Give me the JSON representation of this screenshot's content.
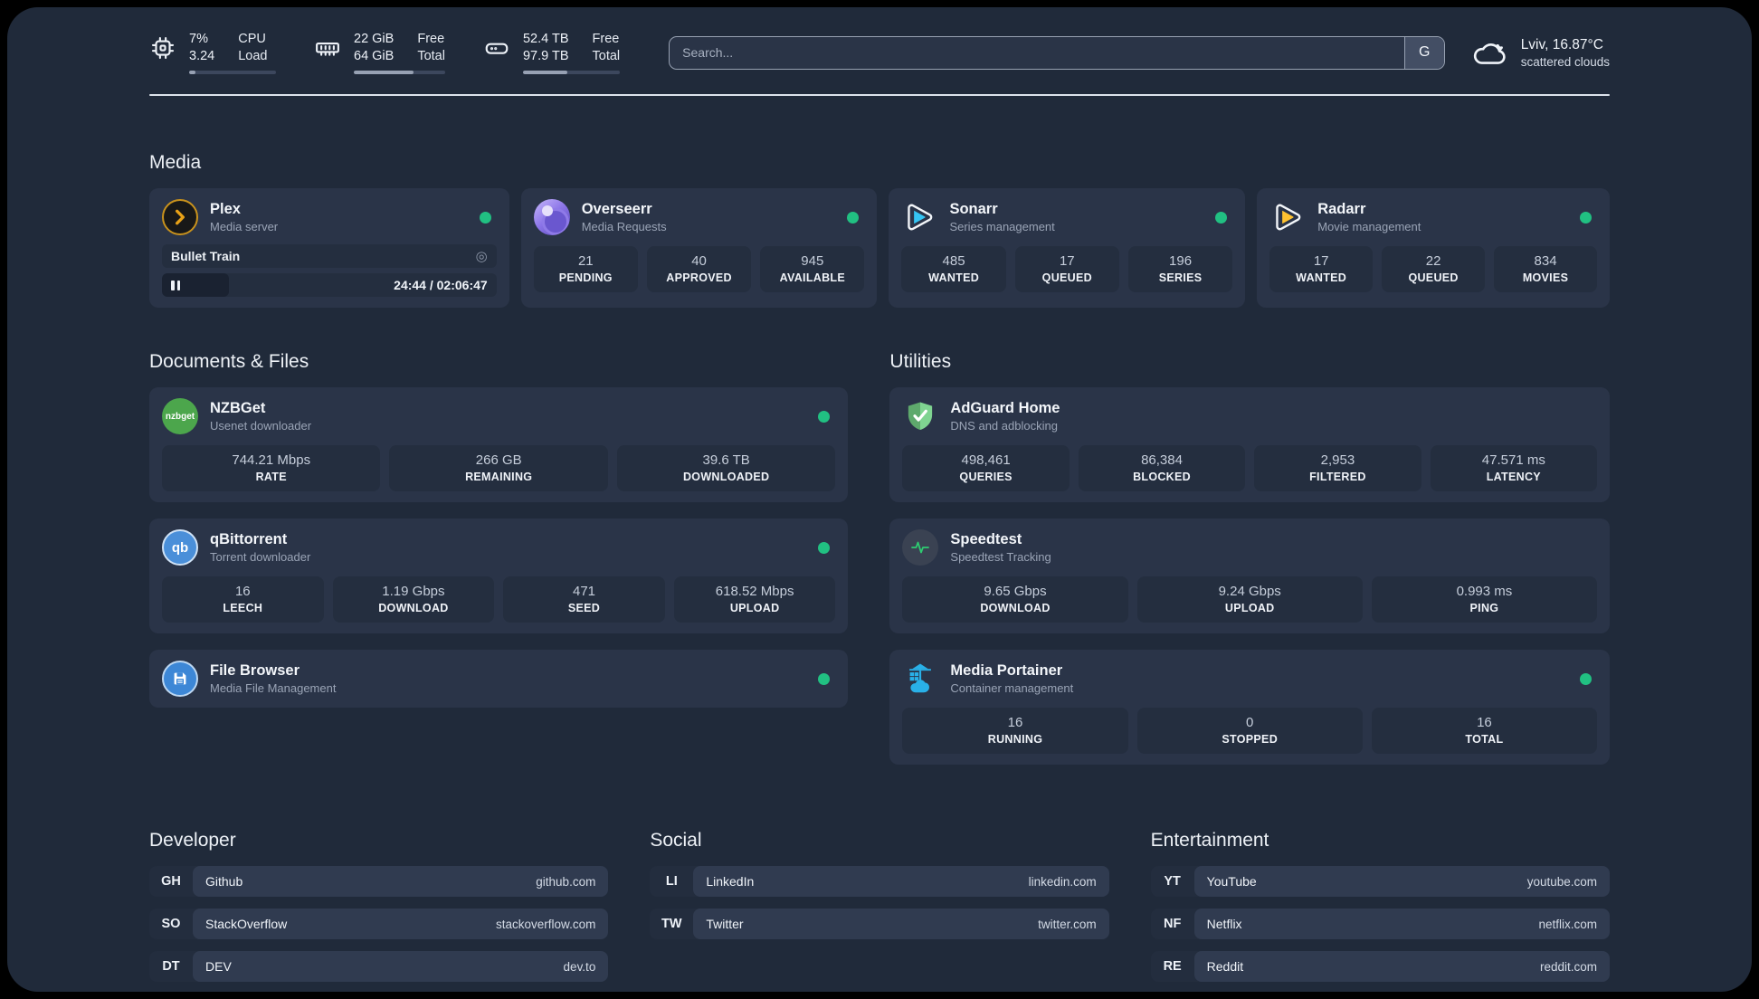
{
  "colors": {
    "background": "#202a3a",
    "card": "#2a3448",
    "tile": "#242e3f",
    "status_online": "#21c082",
    "plex_gold": "#e8a117",
    "sonarr_blue": "#35c5f4",
    "radarr_yellow": "#ffc230",
    "nzbget_green": "#4ca64c",
    "qbittorrent_blue": "#4a8fd9",
    "adguard_green": "#6fbe80",
    "speedtest_pulse": "#2ecc71",
    "portainer_blue": "#29b0e8"
  },
  "header": {
    "cpu": {
      "value_line1": "7%",
      "value_line2": "3.24",
      "label_line1": "CPU",
      "label_line2": "Load",
      "usage_percent": 7
    },
    "memory": {
      "value_line1": "22 GiB",
      "value_line2": "64 GiB",
      "label_line1": "Free",
      "label_line2": "Total",
      "usage_percent": 65
    },
    "storage": {
      "value_line1": "52.4 TB",
      "value_line2": "97.9 TB",
      "label_line1": "Free",
      "label_line2": "Total",
      "usage_percent": 46
    },
    "search": {
      "placeholder": "Search...",
      "engine_label": "G"
    },
    "weather": {
      "location": "Lviv, 16.87°C",
      "condition": "scattered clouds"
    }
  },
  "sections": {
    "media": "Media",
    "documents": "Documents & Files",
    "utilities": "Utilities",
    "developer": "Developer",
    "social": "Social",
    "entertainment": "Entertainment"
  },
  "services": {
    "plex": {
      "title": "Plex",
      "subtitle": "Media server",
      "status": "online",
      "now_playing": {
        "title": "Bullet Train",
        "time": "24:44 / 02:06:47",
        "progress_percent": 20
      }
    },
    "overseerr": {
      "title": "Overseerr",
      "subtitle": "Media Requests",
      "status": "online",
      "stats": [
        {
          "value": "21",
          "label": "PENDING"
        },
        {
          "value": "40",
          "label": "APPROVED"
        },
        {
          "value": "945",
          "label": "AVAILABLE"
        }
      ]
    },
    "sonarr": {
      "title": "Sonarr",
      "subtitle": "Series management",
      "status": "online",
      "stats": [
        {
          "value": "485",
          "label": "WANTED"
        },
        {
          "value": "17",
          "label": "QUEUED"
        },
        {
          "value": "196",
          "label": "SERIES"
        }
      ]
    },
    "radarr": {
      "title": "Radarr",
      "subtitle": "Movie management",
      "status": "online",
      "stats": [
        {
          "value": "17",
          "label": "WANTED"
        },
        {
          "value": "22",
          "label": "QUEUED"
        },
        {
          "value": "834",
          "label": "MOVIES"
        }
      ]
    },
    "nzbget": {
      "title": "NZBGet",
      "subtitle": "Usenet downloader",
      "status": "online",
      "stats": [
        {
          "value": "744.21 Mbps",
          "label": "RATE"
        },
        {
          "value": "266 GB",
          "label": "REMAINING"
        },
        {
          "value": "39.6 TB",
          "label": "DOWNLOADED"
        }
      ]
    },
    "qbittorrent": {
      "title": "qBittorrent",
      "subtitle": "Torrent downloader",
      "status": "online",
      "stats": [
        {
          "value": "16",
          "label": "LEECH"
        },
        {
          "value": "1.19 Gbps",
          "label": "DOWNLOAD"
        },
        {
          "value": "471",
          "label": "SEED"
        },
        {
          "value": "618.52 Mbps",
          "label": "UPLOAD"
        }
      ]
    },
    "filebrowser": {
      "title": "File Browser",
      "subtitle": "Media File Management",
      "status": "online"
    },
    "adguard": {
      "title": "AdGuard Home",
      "subtitle": "DNS and adblocking",
      "stats": [
        {
          "value": "498,461",
          "label": "QUERIES"
        },
        {
          "value": "86,384",
          "label": "BLOCKED"
        },
        {
          "value": "2,953",
          "label": "FILTERED"
        },
        {
          "value": "47.571 ms",
          "label": "LATENCY"
        }
      ]
    },
    "speedtest": {
      "title": "Speedtest",
      "subtitle": "Speedtest Tracking",
      "stats": [
        {
          "value": "9.65 Gbps",
          "label": "DOWNLOAD"
        },
        {
          "value": "9.24 Gbps",
          "label": "UPLOAD"
        },
        {
          "value": "0.993 ms",
          "label": "PING"
        }
      ]
    },
    "portainer": {
      "title": "Media Portainer",
      "subtitle": "Container management",
      "status": "online",
      "stats": [
        {
          "value": "16",
          "label": "RUNNING"
        },
        {
          "value": "0",
          "label": "STOPPED"
        },
        {
          "value": "16",
          "label": "TOTAL"
        }
      ]
    }
  },
  "links": {
    "developer": [
      {
        "abbr": "GH",
        "name": "Github",
        "url": "github.com"
      },
      {
        "abbr": "SO",
        "name": "StackOverflow",
        "url": "stackoverflow.com"
      },
      {
        "abbr": "DT",
        "name": "DEV",
        "url": "dev.to"
      }
    ],
    "social": [
      {
        "abbr": "LI",
        "name": "LinkedIn",
        "url": "linkedin.com"
      },
      {
        "abbr": "TW",
        "name": "Twitter",
        "url": "twitter.com"
      }
    ],
    "entertainment": [
      {
        "abbr": "YT",
        "name": "YouTube",
        "url": "youtube.com"
      },
      {
        "abbr": "NF",
        "name": "Netflix",
        "url": "netflix.com"
      },
      {
        "abbr": "RE",
        "name": "Reddit",
        "url": "reddit.com"
      }
    ]
  },
  "icons": {
    "nzbget_label": "nzbget",
    "qbittorrent_label": "qb"
  }
}
